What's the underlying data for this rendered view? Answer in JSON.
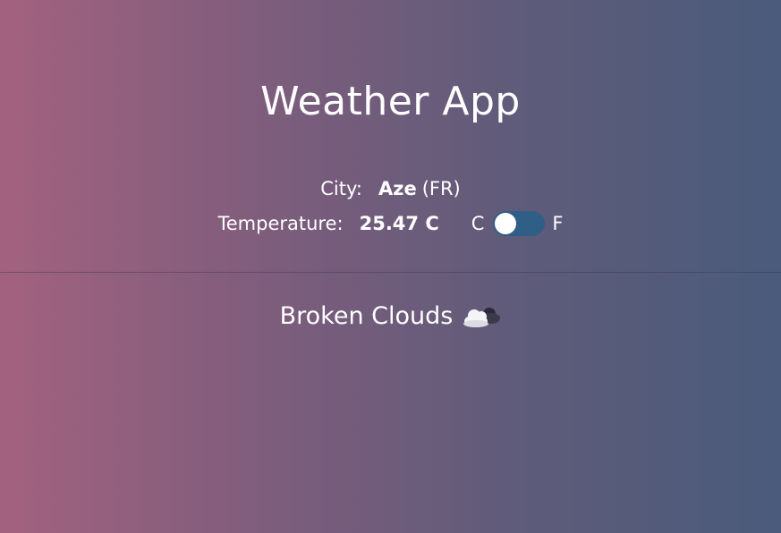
{
  "app": {
    "title": "Weather App"
  },
  "city": {
    "label": "City:",
    "name": "Aze",
    "country": "(FR)"
  },
  "temperature": {
    "label": "Temperature:",
    "value": "25.47 C",
    "unit_left": "C",
    "unit_right": "F",
    "toggle_state": "celsius"
  },
  "conditions": {
    "text": "Broken Clouds",
    "icon": "cloud-sun-icon"
  },
  "colors": {
    "gradient_left": "#a2627f",
    "gradient_right": "#4a5b7b",
    "toggle_track": "#2f5e86",
    "text": "#ffffff"
  }
}
